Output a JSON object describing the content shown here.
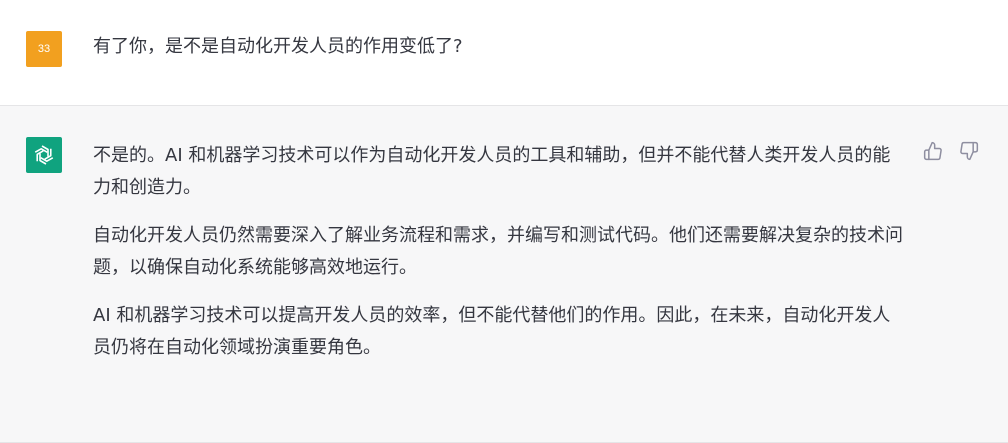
{
  "user_message": {
    "avatar_initials": "33",
    "avatar_color": "#f2a01f",
    "text": "有了你，是不是自动化开发人员的作用变低了?"
  },
  "assistant_message": {
    "avatar_icon": "openai-logo-icon",
    "avatar_color": "#10a37f",
    "paragraphs": [
      "不是的。AI 和机器学习技术可以作为自动化开发人员的工具和辅助，但并不能代替人类开发人员的能力和创造力。",
      "自动化开发人员仍然需要深入了解业务流程和需求，并编写和测试代码。他们还需要解决复杂的技术问题，以确保自动化系统能够高效地运行。",
      "AI 和机器学习技术可以提高开发人员的效率，但不能代替他们的作用。因此，在未来，自动化开发人员仍将在自动化领域扮演重要角色。"
    ],
    "feedback_icons": [
      "thumbs-up-icon",
      "thumbs-down-icon"
    ]
  }
}
